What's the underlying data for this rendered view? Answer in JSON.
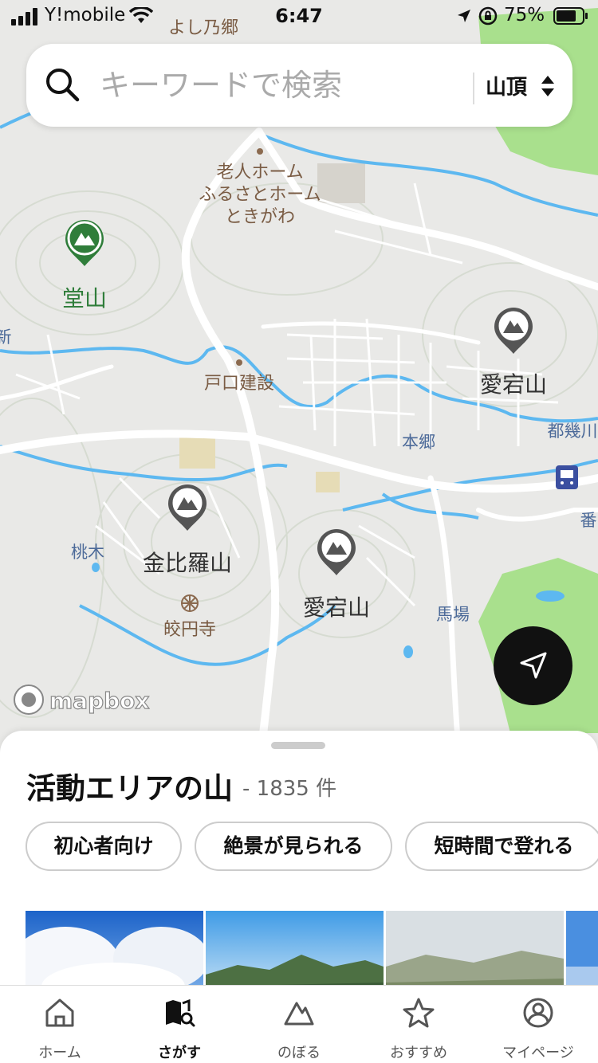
{
  "status_bar": {
    "carrier": "Y!mobile",
    "time": "6:47",
    "battery": "75%"
  },
  "search": {
    "placeholder": "キーワードで検索",
    "sort_label": "山頂"
  },
  "map": {
    "labels": {
      "yoshinogo": "よし乃郷",
      "rojin1": "老人ホーム",
      "rojin2": "ふるさとホーム",
      "rojin3": "ときがわ",
      "doyama": "堂山",
      "toguchi": "戸口建設",
      "atago_right": "愛宕山",
      "togo": "都幾川",
      "hongo": "本郷",
      "konpira": "金比羅山",
      "momoki": "桃木",
      "atago_center": "愛宕山",
      "bamba": "馬場",
      "koenji": "皎円寺",
      "ban": "番",
      "shin": "新"
    },
    "attribution": "mapbox"
  },
  "sheet": {
    "title": "活動エリアの山",
    "count": "- 1835 件"
  },
  "chips": [
    "初心者向け",
    "絶景が見られる",
    "短時間で登れる"
  ],
  "tabs": [
    {
      "label": "ホーム",
      "icon": "home-icon"
    },
    {
      "label": "さがす",
      "icon": "map-search-icon"
    },
    {
      "label": "のぼる",
      "icon": "mountain-icon"
    },
    {
      "label": "おすすめ",
      "icon": "star-icon"
    },
    {
      "label": "マイページ",
      "icon": "profile-icon"
    }
  ],
  "colors": {
    "accent": "#2f7d3a",
    "map_bg": "#e9e9e7",
    "park": "#a9e08d",
    "water": "#5db8f0",
    "road": "#ffffff"
  }
}
